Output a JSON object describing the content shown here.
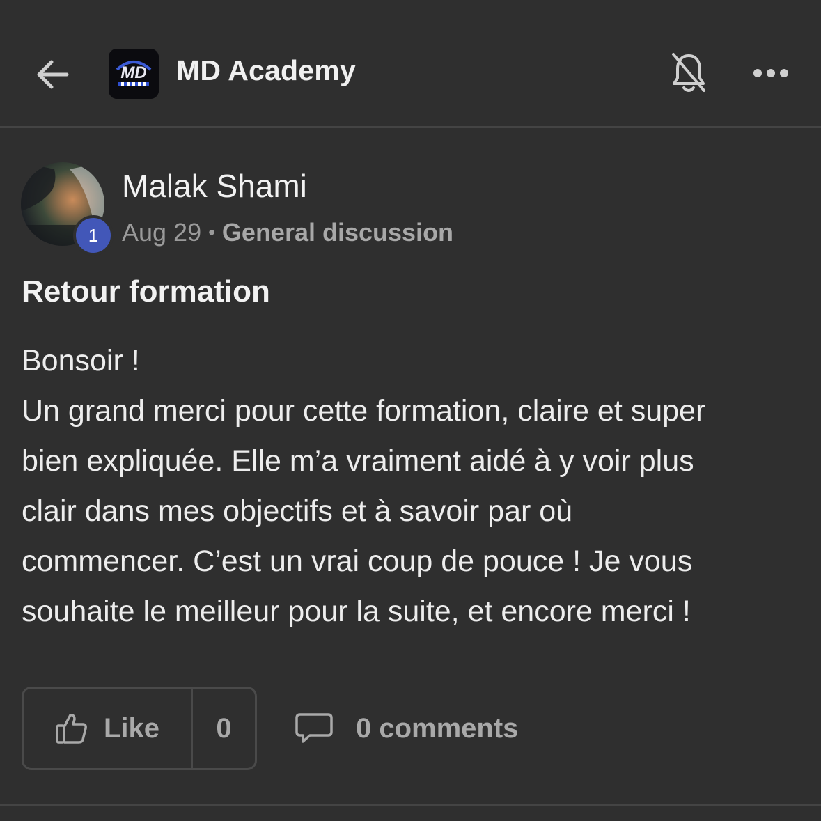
{
  "header": {
    "title": "MD Academy",
    "logo_text": "MD",
    "back_icon": "arrow-left-icon",
    "mute_icon": "bell-off-icon",
    "more_icon": "more-horizontal-icon"
  },
  "post": {
    "author": "Malak Shami",
    "level_badge": "1",
    "date": "Aug 29",
    "separator": "•",
    "category": "General discussion",
    "title": "Retour formation",
    "body_lines": [
      "Bonsoir !",
      "Un grand merci pour cette formation, claire et super",
      "bien expliquée. Elle m’a vraiment aidé à y voir plus",
      "clair dans mes objectifs et à savoir par où",
      "commencer. C’est un vrai coup de pouce ! Je vous",
      "souhaite le meilleur pour la suite, et encore merci !"
    ]
  },
  "actions": {
    "like_label": "Like",
    "like_count": "0",
    "comments_label": "0 comments",
    "like_icon": "thumbs-up-icon",
    "comment_icon": "comment-bubble-icon"
  },
  "colors": {
    "background": "#2f2f2f",
    "badge": "#4257b8",
    "muted_text": "#a9a9a9"
  }
}
